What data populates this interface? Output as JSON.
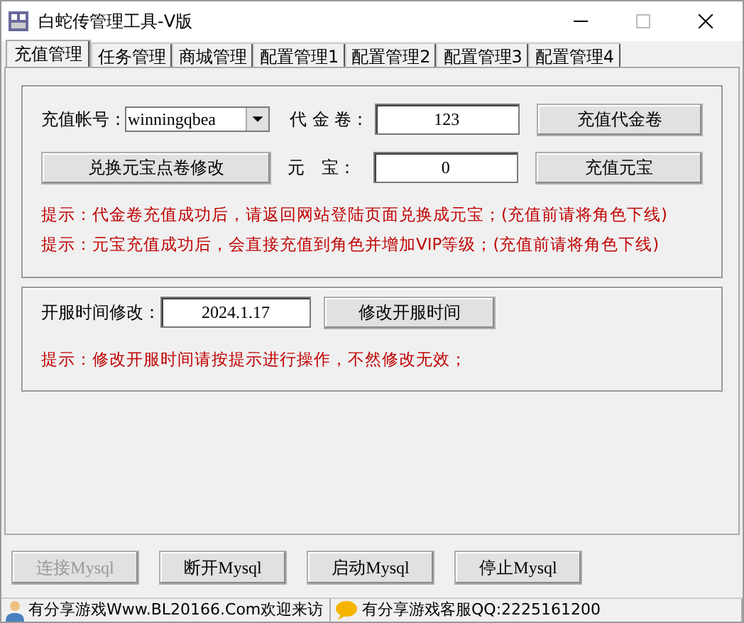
{
  "window": {
    "title": "白蛇传管理工具-V版"
  },
  "tabs": [
    {
      "label": "充值管理",
      "selected": true
    },
    {
      "label": "任务管理",
      "selected": false
    },
    {
      "label": "商城管理",
      "selected": false
    },
    {
      "label": "配置管理1",
      "selected": false
    },
    {
      "label": "配置管理2",
      "selected": false
    },
    {
      "label": "配置管理3",
      "selected": false
    },
    {
      "label": "配置管理4",
      "selected": false
    }
  ],
  "recharge": {
    "account_label": "充值帐号：",
    "account_value": "winningqbea",
    "voucher_label": "代 金 卷：",
    "voucher_value": "123",
    "voucher_button": "充值代金卷",
    "exchange_button": "兑换元宝点卷修改",
    "yuanbao_label": "元　宝：",
    "yuanbao_value": "0",
    "yuanbao_button": "充值元宝",
    "tips": [
      "提示：代金卷充值成功后，请返回网站登陆页面兑换成元宝；(充值前请将角色下线)",
      "提示：元宝充值成功后，会直接充值到角色并增加VIP等级；(充值前请将角色下线)"
    ]
  },
  "open_time": {
    "label": "开服时间修改：",
    "value": "2024.1.17",
    "button": "修改开服时间",
    "tip": "提示：修改开服时间请按提示进行操作，不然修改无效；"
  },
  "mysql_buttons": [
    {
      "label": "连接Mysql",
      "disabled": true
    },
    {
      "label": "断开Mysql",
      "disabled": false
    },
    {
      "label": "启动Mysql",
      "disabled": false
    },
    {
      "label": "停止Mysql",
      "disabled": false
    }
  ],
  "status_bar": [
    "有分享游戏Www.BL20166.Com欢迎来访",
    "有分享游戏客服QQ:2225161200"
  ]
}
